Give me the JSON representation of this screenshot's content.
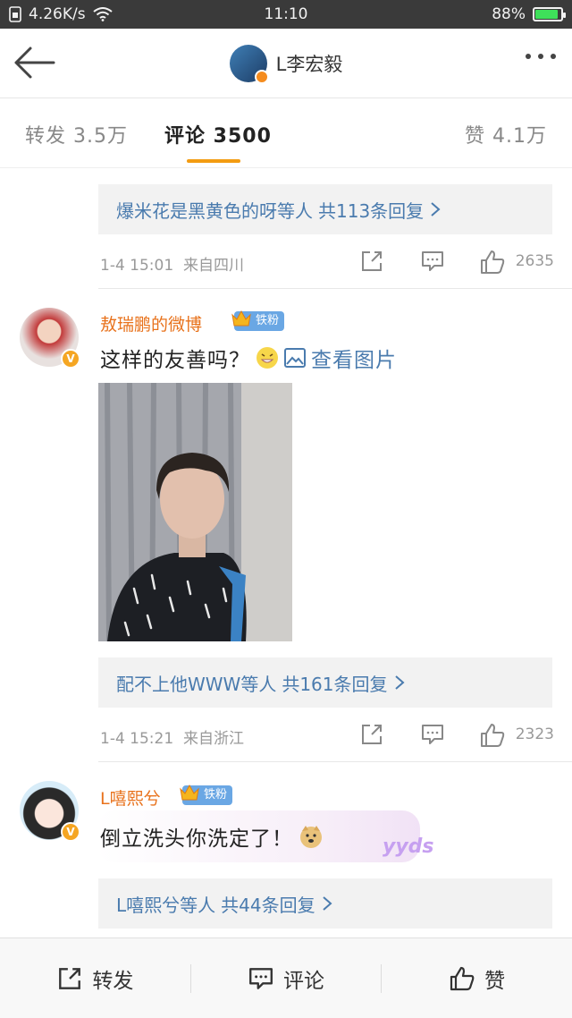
{
  "status_bar": {
    "speed": "4.26K/s",
    "time": "11:10",
    "battery": "88%",
    "battery_level": 0.88
  },
  "header": {
    "title": "L李宏毅"
  },
  "tabs": {
    "repost": "转发 3.5万",
    "comment": "评论 3500",
    "like": "赞 4.1万"
  },
  "comments": [
    {
      "reply_summary": "爆米花是黑黄色的呀等人",
      "reply_count": "共113条回复",
      "time": "1-4 15:01",
      "location": "来自四川",
      "likes": "2635"
    },
    {
      "user": "敖瑞鹏的微博",
      "fan_badge": "铁粉",
      "text": "这样的友善吗？",
      "view_image": "查看图片",
      "reply_summary": "配不上他WWW等人",
      "reply_count": "共161条回复",
      "time": "1-4 15:21",
      "location": "来自浙江",
      "likes": "2323"
    },
    {
      "user": "L嘻熙兮",
      "fan_badge": "铁粉",
      "text": "倒立洗头你洗定了！",
      "sticker_text": "yyds",
      "reply_summary": "L嘻熙兮等人",
      "reply_count": "共44条回复"
    }
  ],
  "bottom_bar": {
    "repost": "转发",
    "comment": "评论",
    "like": "赞"
  },
  "colors": {
    "accent": "#f39c12",
    "link": "#4a7bae",
    "username": "#e8721c",
    "fan_badge": "#6aa7e4"
  }
}
